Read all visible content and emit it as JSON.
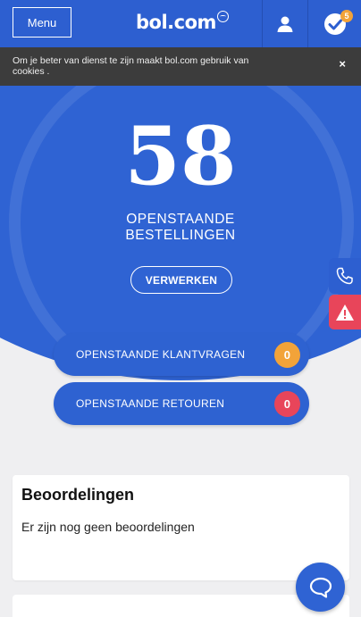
{
  "header": {
    "menu_label": "Menu",
    "logo_text": "bol.com",
    "orders_badge": "5"
  },
  "cookie_bar": {
    "text": "Om je beter van dienst te zijn maakt bol.com gebruik van",
    "link": "cookies",
    "suffix": " .",
    "close": "×"
  },
  "hero": {
    "count": "58",
    "label_line1": "OPENSTAANDE",
    "label_line2": "BESTELLINGEN",
    "button": "VERWERKEN"
  },
  "pills": [
    {
      "label": "OPENSTAANDE KLANTVRAGEN",
      "count": "0",
      "color": "#f2a339"
    },
    {
      "label": "OPENSTAANDE RETOUREN",
      "count": "0",
      "color": "#e8455a"
    }
  ],
  "reviews": {
    "title": "Beoordelingen",
    "empty_text": "Er zijn nog geen beoordelingen"
  },
  "colors": {
    "brand_blue": "#2f63d3",
    "orange": "#f2a339",
    "red": "#e8455a"
  },
  "icons": [
    "user-icon",
    "check-icon",
    "close-icon",
    "phone-icon",
    "warning-icon",
    "chat-icon"
  ]
}
